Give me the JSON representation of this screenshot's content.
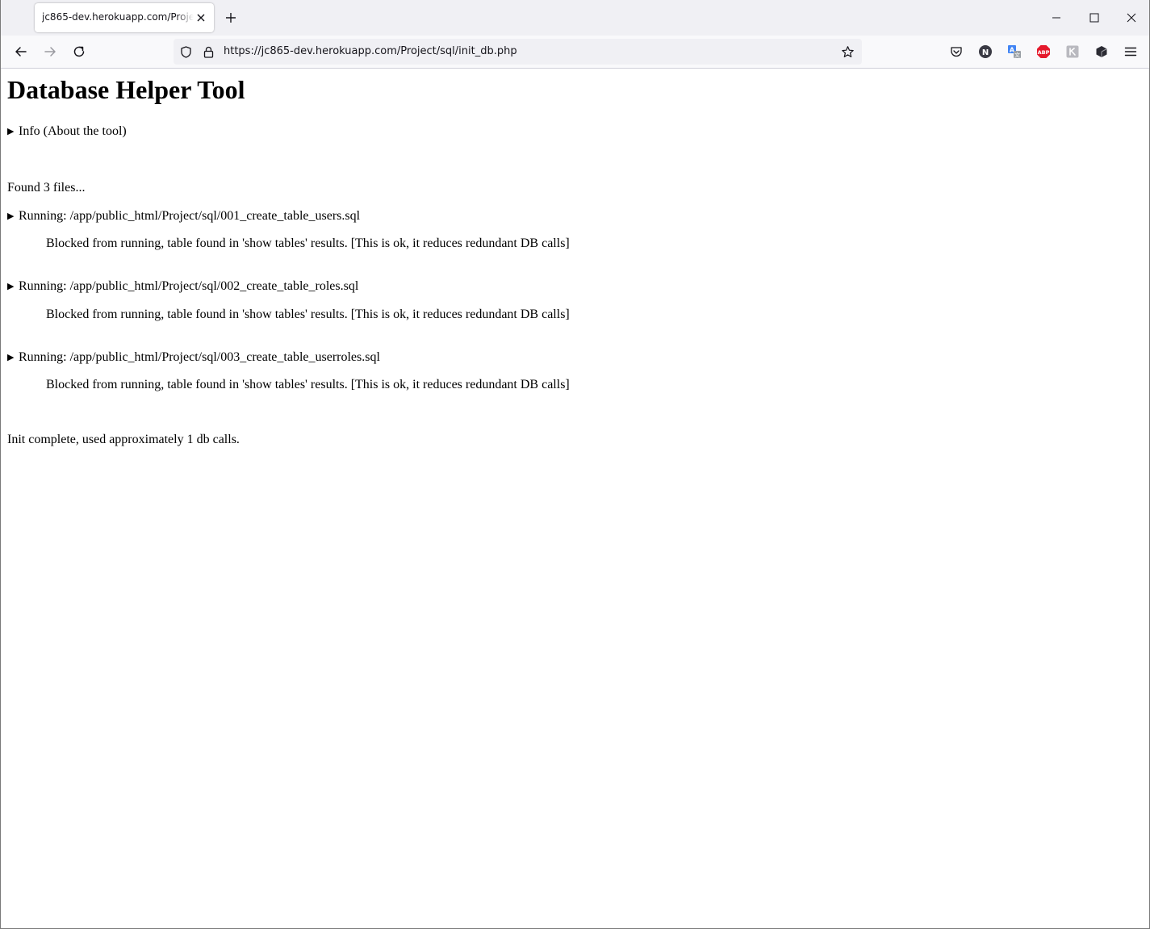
{
  "browser": {
    "tab_title": "jc865-dev.herokuapp.com/Project/sql/init_db.php",
    "url": "https://jc865-dev.herokuapp.com/Project/sql/init_db.php",
    "icons": {
      "close_tab": "close-icon",
      "new_tab": "plus-icon",
      "back": "arrow-left-icon",
      "forward": "arrow-right-icon",
      "reload": "reload-icon",
      "tracking": "shield-icon",
      "lock": "lock-icon",
      "bookmark": "star-icon",
      "pocket": "pocket-icon",
      "menu": "hamburger-icon"
    },
    "extensions": [
      "pocket",
      "N",
      "translate",
      "ABP",
      "extension-grey",
      "extension-cube"
    ]
  },
  "page": {
    "heading": "Database Helper Tool",
    "info_summary": "Info (About the tool)",
    "found_text": "Found 3 files...",
    "files": [
      {
        "running": "Running: /app/public_html/Project/sql/001_create_table_users.sql",
        "message": "Blocked from running, table found in 'show tables' results. [This is ok, it reduces redundant DB calls]"
      },
      {
        "running": "Running: /app/public_html/Project/sql/002_create_table_roles.sql",
        "message": "Blocked from running, table found in 'show tables' results. [This is ok, it reduces redundant DB calls]"
      },
      {
        "running": "Running: /app/public_html/Project/sql/003_create_table_userroles.sql",
        "message": "Blocked from running, table found in 'show tables' results. [This is ok, it reduces redundant DB calls]"
      }
    ],
    "complete_text": "Init complete, used approximately 1 db calls."
  }
}
